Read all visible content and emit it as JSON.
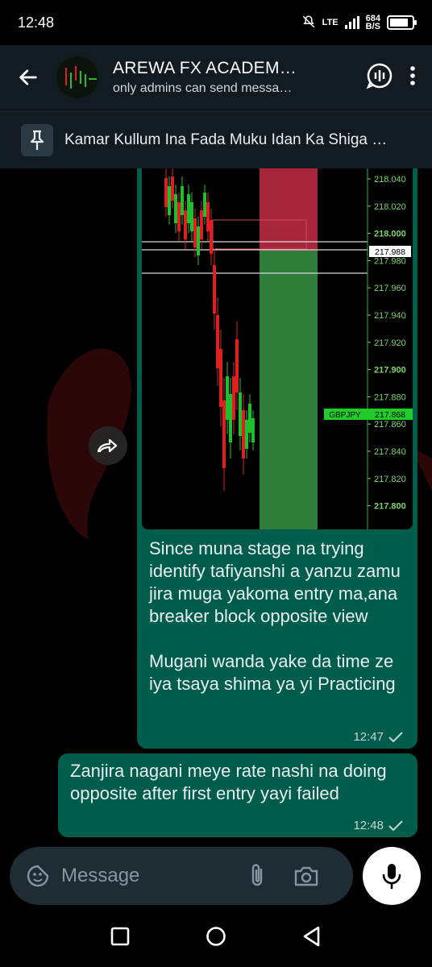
{
  "status": {
    "time": "12:48",
    "network": "LTE",
    "speed_value": "684",
    "speed_unit": "B/S",
    "battery_level": 0.85
  },
  "header": {
    "title": "AREWA FX ACADEM…",
    "subtitle": "only admins can send messa…",
    "icons": [
      "back-arrow-icon",
      "voice-chat-icon",
      "more-vertical-icon"
    ]
  },
  "pinned": {
    "text": "Kamar Kullum Ina Fada Muku Idan Ka Shiga …"
  },
  "chart": {
    "price_labels": [
      "218.040",
      "218.020",
      "218.000",
      "217.980",
      "217.960",
      "217.940",
      "217.920",
      "217.900",
      "217.880",
      "217.860",
      "217.840",
      "217.820",
      "217.800"
    ],
    "current_price": "217.988",
    "symbol": "GBPJPY",
    "symbol_price": "217.868",
    "colors": {
      "bull": "#1fbf2f",
      "bear": "#e02020",
      "stop_zone": "#a8263a",
      "target_zone": "#2e7d3a",
      "axis_text": "#7fd36b"
    }
  },
  "messages": [
    {
      "text": "Since muna stage na trying identify tafiyanshi a yanzu zamu jira muga yakoma entry ma,ana breaker block opposite view\n\nMugani wanda yake da time ze iya tsaya shima ya yi Practicing",
      "time": "12:47"
    },
    {
      "text": "Zanjira nagani meye  rate nashi na doing opposite after first entry yayi failed",
      "time": "12:48"
    }
  ],
  "composer": {
    "placeholder": "Message",
    "icons": [
      "sticker-icon",
      "attach-icon",
      "camera-icon",
      "mic-icon"
    ]
  },
  "navbar": {
    "icons": [
      "recent-apps-icon",
      "home-icon",
      "back-nav-icon"
    ]
  }
}
